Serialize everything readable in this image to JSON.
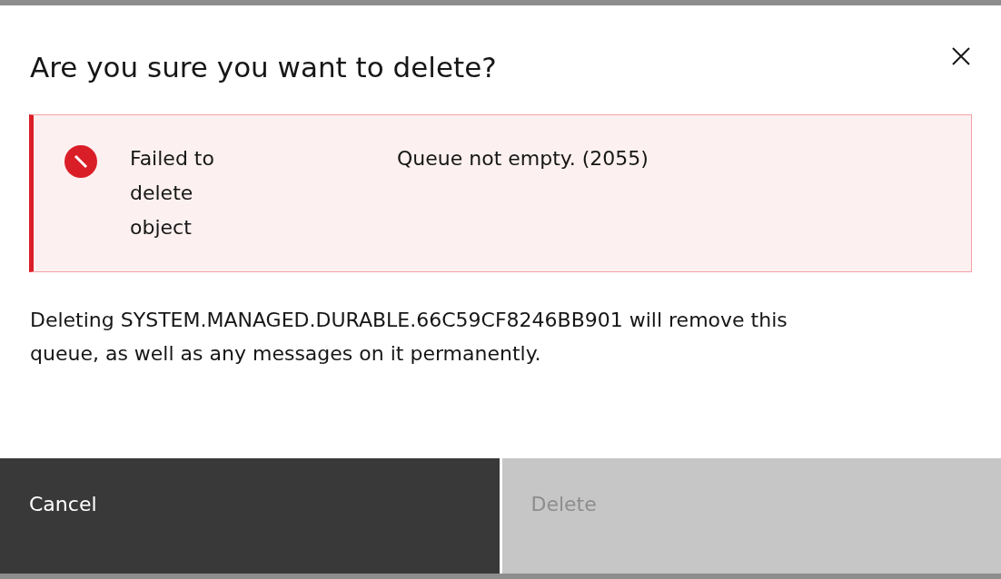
{
  "dialog": {
    "title": "Are you sure you want to delete?"
  },
  "notification": {
    "kind": "error",
    "title": "Failed to delete object",
    "message": "Queue not empty. (2055)"
  },
  "body": "Deleting SYSTEM.MANAGED.DURABLE.66C59CF8246BB901 will remove this queue, as well as any messages on it permanently.",
  "buttons": [
    {
      "label": "Cancel",
      "kind": "secondary",
      "disabled": false
    },
    {
      "label": "Delete",
      "kind": "danger",
      "disabled": true
    }
  ]
}
